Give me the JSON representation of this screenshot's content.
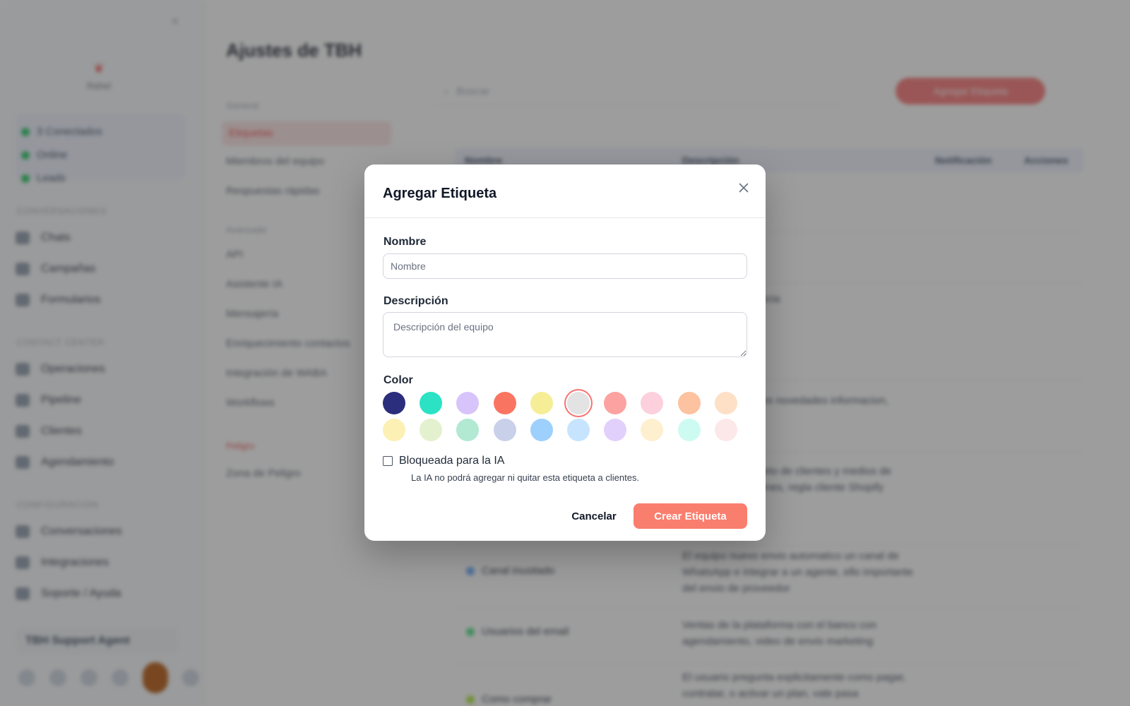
{
  "background": {
    "brand_name": "Rahel",
    "status_items": [
      "3 Conectados",
      "Online",
      "Leads"
    ],
    "nav_sections": [
      "Conversaciones",
      "Contact Center",
      "Configuración"
    ],
    "nav_items": [
      "Chats",
      "Campañas",
      "Formularios",
      "Operaciones",
      "Pipeline",
      "Clientes",
      "Agendamiento",
      "Conversaciones",
      "Integraciones",
      "Soporte / Ayuda"
    ],
    "workspace_name": "TBH Support Agent",
    "page_title": "Ajustes de TBH",
    "settings_heads": [
      "General",
      "Avanzado",
      "Peligro"
    ],
    "settings_items": [
      "Etiquetas",
      "Miembros del equipo",
      "Respuestas rápidas",
      "API",
      "Asistente IA",
      "Mensajería",
      "Enriquecimiento contactos",
      "Integración de WABA",
      "Workflows",
      "Zona de Peligro"
    ],
    "search_placeholder": "Buscar",
    "add_tag_label": "Agregar Etiqueta",
    "table_headers": [
      "Nombre",
      "Descripción",
      "Notificación",
      "Acciones"
    ],
    "rows": [
      {
        "name": "",
        "description": ""
      },
      {
        "name": "",
        "description": ""
      },
      {
        "name": "",
        "description": "del lagarto audiencia"
      },
      {
        "name": "",
        "description": ""
      },
      {
        "name": "",
        "description": "pregunta ABI sobre novedades informacion, portales y"
      },
      {
        "name": "",
        "description": "ago desde completo de clientes y medios de ventas informaciones, regla cliente Shopify"
      },
      {
        "name": "Canal inusitado",
        "description": "El equipo nuevo envio automatico un canal de WhatsApp e integrar a un agente, ello importante del envio de proveedor"
      },
      {
        "name": "Usuarios del email",
        "description": "Ventas de la plataforma con el banco con agendamiento, video de envio marketing"
      },
      {
        "name": "Como comprar",
        "description": "El usuario pregunta explicitamente como pagar, contratar, o activar un plan, vale pasa"
      }
    ]
  },
  "modal": {
    "title": "Agregar Etiqueta",
    "name_label": "Nombre",
    "name_placeholder": "Nombre",
    "description_label": "Descripción",
    "description_placeholder": "Descripción del equipo",
    "color_label": "Color",
    "colors": [
      "#2b2d7d",
      "#2be3c4",
      "#d7c4fa",
      "#fa7561",
      "#f6ee97",
      "#e3e3e3",
      "#fca2a0",
      "#fdd0de",
      "#fdc29f",
      "#fde0c6",
      "#fdf0b4",
      "#e3f1cf",
      "#b1e9d3",
      "#c9d0ea",
      "#9ed0fd",
      "#c6e4fd",
      "#e2d0fc",
      "#fef0cf",
      "#cdfbf2",
      "#fde8e9"
    ],
    "selected_color_index": 5,
    "checkbox_label": "Bloqueada para la IA",
    "checkbox_checked": false,
    "checkbox_help": "La IA no podrá agregar ni quitar esta etiqueta a clientes.",
    "cancel_label": "Cancelar",
    "create_label": "Crear Etiqueta"
  }
}
